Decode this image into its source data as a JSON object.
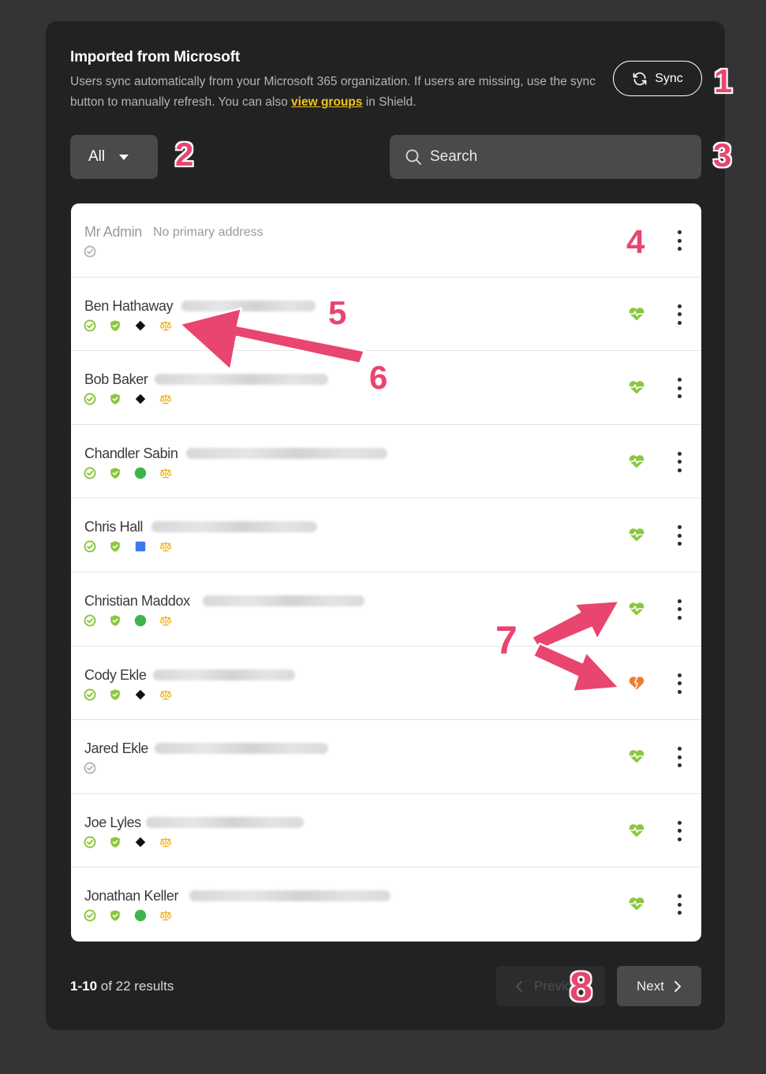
{
  "header": {
    "title": "Imported from Microsoft",
    "desc_before": "Users sync automatically from your Microsoft 365 organization. If users are missing, use the sync button to manually refresh. You can also ",
    "link_text": "view groups",
    "desc_after": " in Shield.",
    "sync_label": "Sync"
  },
  "filter": {
    "selected": "All"
  },
  "search": {
    "placeholder": "Search"
  },
  "colors": {
    "accent_link": "#f0c419",
    "healthy": "#8cc63f",
    "warning": "#ef7d2d",
    "annotation": "#e8456f"
  },
  "users": [
    {
      "name": "Mr Admin",
      "sub": "No primary address",
      "muted": true,
      "badges": [
        "check-gray"
      ],
      "health": "none"
    },
    {
      "name": "Ben Hathaway",
      "badges": [
        "check",
        "shield",
        "diamond",
        "scale"
      ],
      "health": "good"
    },
    {
      "name": "Bob Baker",
      "badges": [
        "check",
        "shield",
        "diamond",
        "scale"
      ],
      "health": "good"
    },
    {
      "name": "Chandler Sabin",
      "badges": [
        "check",
        "shield",
        "circle",
        "scale"
      ],
      "health": "good"
    },
    {
      "name": "Chris Hall",
      "badges": [
        "check",
        "shield",
        "square",
        "scale"
      ],
      "health": "good"
    },
    {
      "name": "Christian Maddox",
      "badges": [
        "check",
        "shield",
        "circle",
        "scale"
      ],
      "health": "good"
    },
    {
      "name": "Cody Ekle",
      "badges": [
        "check",
        "shield",
        "diamond",
        "scale"
      ],
      "health": "warning"
    },
    {
      "name": "Jared Ekle",
      "badges": [
        "check-gray"
      ],
      "health": "good"
    },
    {
      "name": "Joe Lyles",
      "badges": [
        "check",
        "shield",
        "diamond",
        "scale"
      ],
      "health": "good"
    },
    {
      "name": "Jonathan Keller",
      "badges": [
        "check",
        "shield",
        "circle",
        "scale"
      ],
      "health": "good"
    }
  ],
  "pagination": {
    "range": "1-10",
    "of_text": "of 22 results",
    "prev_label": "Previous",
    "next_label": "Next"
  },
  "callouts": [
    "1",
    "2",
    "3",
    "4",
    "5",
    "6",
    "7",
    "8"
  ]
}
